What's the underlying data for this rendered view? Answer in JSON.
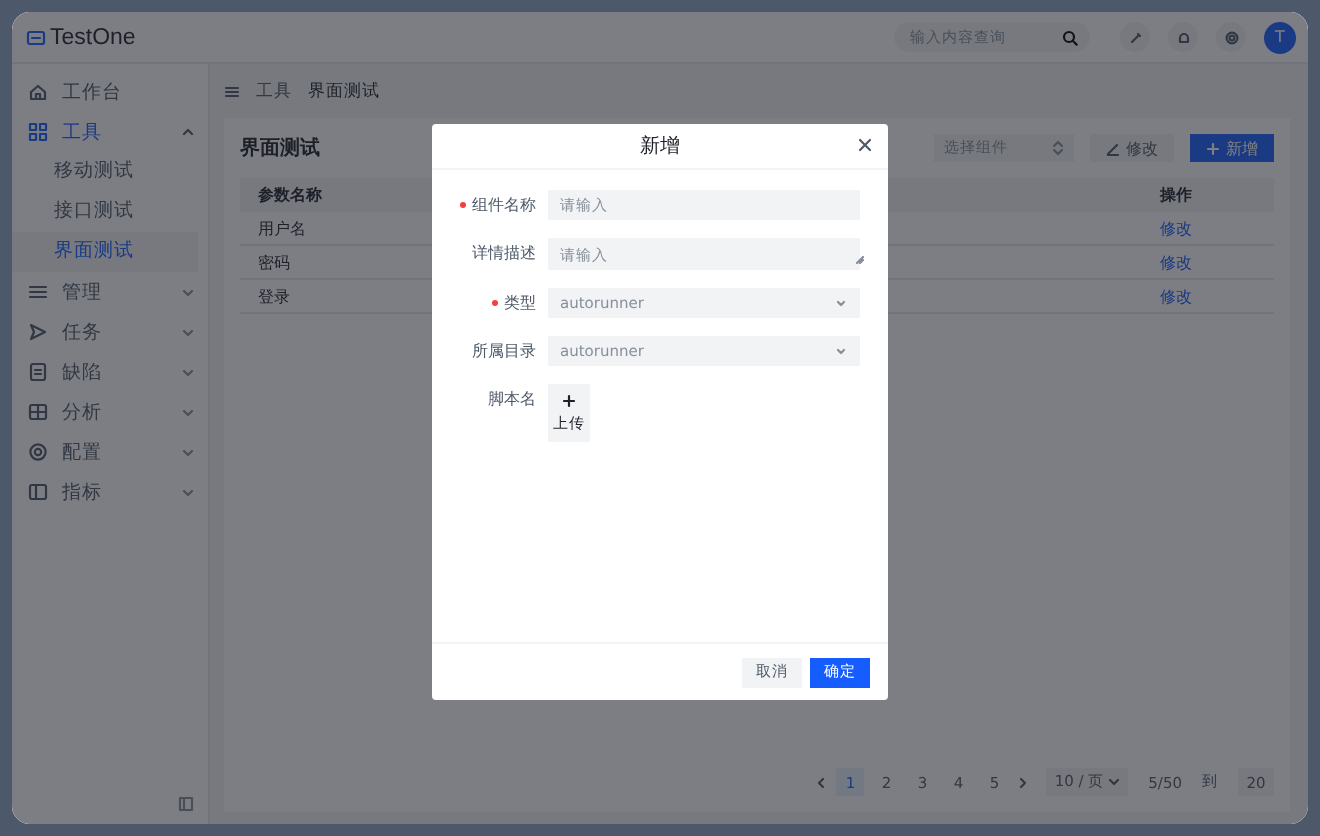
{
  "logo": "TestOne",
  "header": {
    "search": {
      "placeholder": "输入内容查询"
    },
    "avatar": "T"
  },
  "sidebar": {
    "items": [
      {
        "label": "工作台",
        "kind": "link",
        "selected": false
      },
      {
        "label": "工具",
        "kind": "group",
        "selected": true,
        "expanded": true,
        "children": [
          {
            "label": "移动测试",
            "selected": false
          },
          {
            "label": "接口测试",
            "selected": false
          },
          {
            "label": "界面测试",
            "selected": true
          }
        ]
      },
      {
        "label": "管理",
        "kind": "group",
        "selected": false,
        "expanded": false
      },
      {
        "label": "任务",
        "kind": "group",
        "selected": false,
        "expanded": false
      },
      {
        "label": "缺陷",
        "kind": "group",
        "selected": false,
        "expanded": false
      },
      {
        "label": "分析",
        "kind": "group",
        "selected": false,
        "expanded": false
      },
      {
        "label": "配置",
        "kind": "group",
        "selected": false,
        "expanded": false
      },
      {
        "label": "指标",
        "kind": "group",
        "selected": false,
        "expanded": false
      }
    ]
  },
  "breadcrumb": [
    "工具",
    "界面测试"
  ],
  "card": {
    "title": "界面测试",
    "select": {
      "placeholder": "选择组件"
    },
    "edit_button": "修改",
    "add_button": "新增"
  },
  "table": {
    "columns": [
      "参数名称",
      "操作"
    ],
    "rows": [
      {
        "name": "用户名",
        "action": "修改"
      },
      {
        "name": "密码",
        "action": "修改"
      },
      {
        "name": "登录",
        "action": "修改"
      }
    ]
  },
  "pagination": {
    "pages": [
      {
        "label": "1",
        "selected": true
      },
      {
        "label": "2",
        "selected": false
      },
      {
        "label": "3",
        "selected": false
      },
      {
        "label": "4",
        "selected": false
      },
      {
        "label": "5",
        "selected": false
      }
    ],
    "page_size": "10 / 页",
    "summary": "5/50",
    "goto_label": "到",
    "goto_value": "20"
  },
  "modal": {
    "title": "新增",
    "fields": [
      {
        "label": "组件名称",
        "required": true,
        "kind": "input",
        "placeholder": "请输入"
      },
      {
        "label": "详情描述",
        "required": false,
        "kind": "textarea",
        "placeholder": "请输入"
      },
      {
        "label": "类型",
        "required": true,
        "kind": "select",
        "placeholder": "autorunner"
      },
      {
        "label": "所属目录",
        "required": false,
        "kind": "select",
        "placeholder": "autorunner"
      },
      {
        "label": "脚本名",
        "required": false,
        "kind": "upload",
        "button": "上传"
      }
    ],
    "cancel": "取消",
    "ok": "确定"
  }
}
